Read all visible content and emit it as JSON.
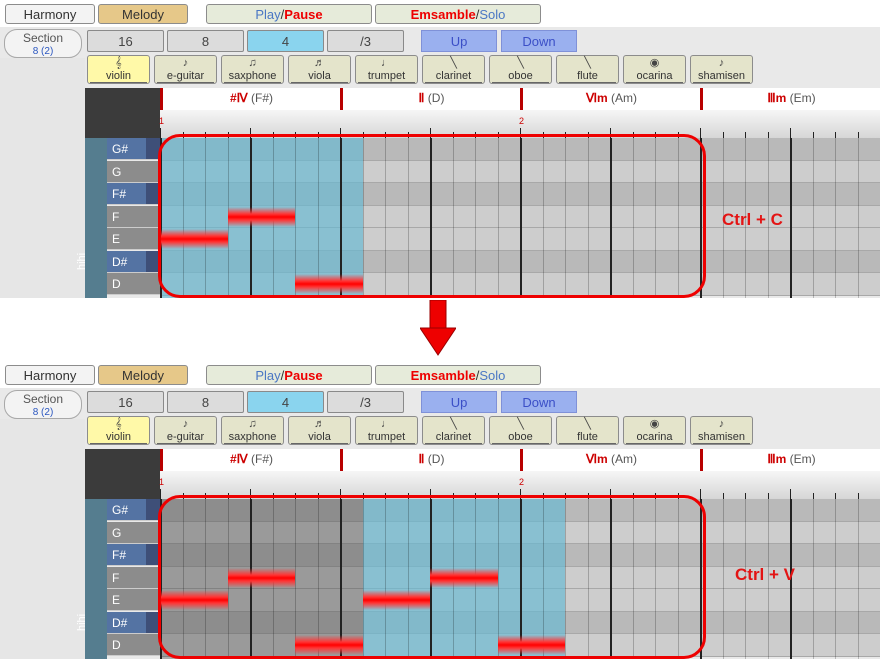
{
  "toolbar": {
    "harmony": "Harmony",
    "melody": "Melody",
    "play": "Play",
    "play_sep": " / ",
    "pause": "Pause",
    "ensemble": "Emsamble",
    "ens_sep": " / ",
    "solo": "Solo"
  },
  "section": {
    "label": "Section",
    "value": "8 (2)"
  },
  "divisions": [
    "16",
    "8",
    "4",
    "/3"
  ],
  "selected_division": "4",
  "transpose": {
    "up": "Up",
    "down": "Down"
  },
  "instruments": [
    {
      "label": "violin",
      "icon": "violin-icon",
      "selected": true
    },
    {
      "label": "e-guitar",
      "icon": "e-guitar-icon"
    },
    {
      "label": "saxphone",
      "icon": "saxophone-icon"
    },
    {
      "label": "viola",
      "icon": "viola-icon"
    },
    {
      "label": "trumpet",
      "icon": "trumpet-icon"
    },
    {
      "label": "clarinet",
      "icon": "clarinet-icon"
    },
    {
      "label": "oboe",
      "icon": "oboe-icon"
    },
    {
      "label": "flute",
      "icon": "flute-icon"
    },
    {
      "label": "ocarina",
      "icon": "ocarina-icon"
    },
    {
      "label": "shamisen",
      "icon": "shamisen-icon"
    }
  ],
  "chords": [
    {
      "roman": "#Ⅳ",
      "name": "(F#)"
    },
    {
      "roman": "Ⅱ",
      "name": "(D)"
    },
    {
      "roman": "Ⅵm",
      "name": "(Am)"
    },
    {
      "roman": "Ⅲm",
      "name": "(Em)"
    }
  ],
  "ruler_numbers": [
    "1",
    "2"
  ],
  "track_name": "hihi",
  "keys": [
    "G#",
    "G",
    "F#",
    "F",
    "E",
    "D#",
    "D"
  ],
  "colors": {
    "selection": "#e00000",
    "note": "#ff0000",
    "highlight": "#7fb3c3"
  },
  "panels": [
    {
      "caption": "Ctrl + C",
      "notes": [
        {
          "pitch": "E",
          "start": 0,
          "len": 2
        },
        {
          "pitch": "F",
          "start": 2,
          "len": 2
        },
        {
          "pitch": "D",
          "start": 4,
          "len": 2
        }
      ],
      "highlight": {
        "start": 0,
        "len": 6
      }
    },
    {
      "caption": "Ctrl + V",
      "notes": [
        {
          "pitch": "E",
          "start": 0,
          "len": 2
        },
        {
          "pitch": "F",
          "start": 2,
          "len": 2
        },
        {
          "pitch": "D",
          "start": 4,
          "len": 2
        },
        {
          "pitch": "E",
          "start": 6,
          "len": 2
        },
        {
          "pitch": "F",
          "start": 8,
          "len": 2
        },
        {
          "pitch": "D",
          "start": 10,
          "len": 2
        }
      ],
      "highlight": {
        "start": 6,
        "len": 6
      }
    }
  ]
}
